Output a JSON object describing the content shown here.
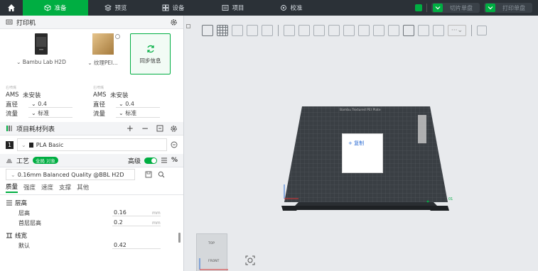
{
  "topbar": {
    "tabs": [
      {
        "label": "准备",
        "icon": "cube-icon"
      },
      {
        "label": "预览",
        "icon": "layers-icon"
      },
      {
        "label": "设备",
        "icon": "devices-icon"
      },
      {
        "label": "项目",
        "icon": "project-icon"
      },
      {
        "label": "校准",
        "icon": "calibration-icon"
      }
    ],
    "slice_label": "切片单盘",
    "print_label": "打印单盘",
    "accent": "#00ae42",
    "bar_color": "#2b3137"
  },
  "printer_section": {
    "title": "打印机",
    "printer_name": "Bambu Lab H2D",
    "plate_name": "纹理PEI...",
    "sync_label": "同步信息",
    "left_tiny": "右喷嘴",
    "right_tiny": "右喷嘴",
    "left": {
      "ams_key": "AMS",
      "ams_val": "未安装",
      "dia_key": "直径",
      "dia_val": "0.4",
      "flow_key": "流量",
      "flow_val": "标准"
    },
    "right": {
      "ams_key": "AMS",
      "ams_val": "未安装",
      "dia_key": "直径",
      "dia_val": "0.4",
      "flow_key": "流量",
      "flow_val": "标准"
    }
  },
  "filament_section": {
    "title": "项目耗材列表",
    "item_index": "1",
    "item_name": "PLA Basic"
  },
  "process_section": {
    "title": "工艺",
    "chip_label": "全局",
    "chip_suffix": "对象",
    "advanced_label": "高级",
    "preset": "0.16mm Balanced Quality @BBL H2D",
    "subtabs": [
      "质量",
      "强度",
      "速度",
      "支撑",
      "其他"
    ],
    "group_layer": "层高",
    "layer_height_label": "层高",
    "layer_height_value": "0.16",
    "first_layer_label": "首层层高",
    "first_layer_value": "0.2",
    "unit": "mm",
    "group_line": "线宽",
    "line_width_label": "默认",
    "line_width_value": "0.42"
  },
  "canvas": {
    "plate_label": "Bambu Textured PEI Plate",
    "copy_label": "+ 复制",
    "plate_number": "01",
    "more_label": "···",
    "cube_top": "TOP",
    "cube_front": "FRONT"
  }
}
